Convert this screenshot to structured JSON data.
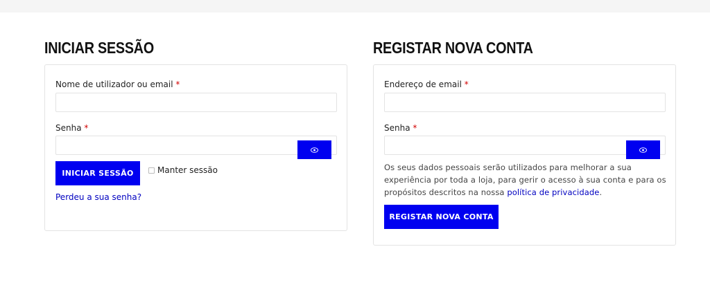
{
  "login": {
    "heading": "INICIAR SESSÃO",
    "username_label": "Nome de utilizador ou email",
    "required_mark": "*",
    "password_label": "Senha",
    "submit_label": "INICIAR SESSÃO",
    "remember_label": "Manter sessão",
    "lost_password_link": "Perdeu a sua senha?"
  },
  "register": {
    "heading": "REGISTAR NOVA CONTA",
    "email_label": "Endereço de email",
    "required_mark": "*",
    "password_label": "Senha",
    "privacy_text": "Os seus dados pessoais serão utilizados para melhorar a sua experiência por toda a loja, para gerir o acesso à sua conta e para os propósitos descritos na nossa",
    "privacy_link": "política de privacidade",
    "privacy_end": ".",
    "submit_label": "REGISTAR NOVA CONTA"
  },
  "colors": {
    "accent": "#0000f0",
    "link": "#0000c0",
    "required": "#d10000"
  },
  "icons": {
    "password_toggle": "eye-icon"
  }
}
